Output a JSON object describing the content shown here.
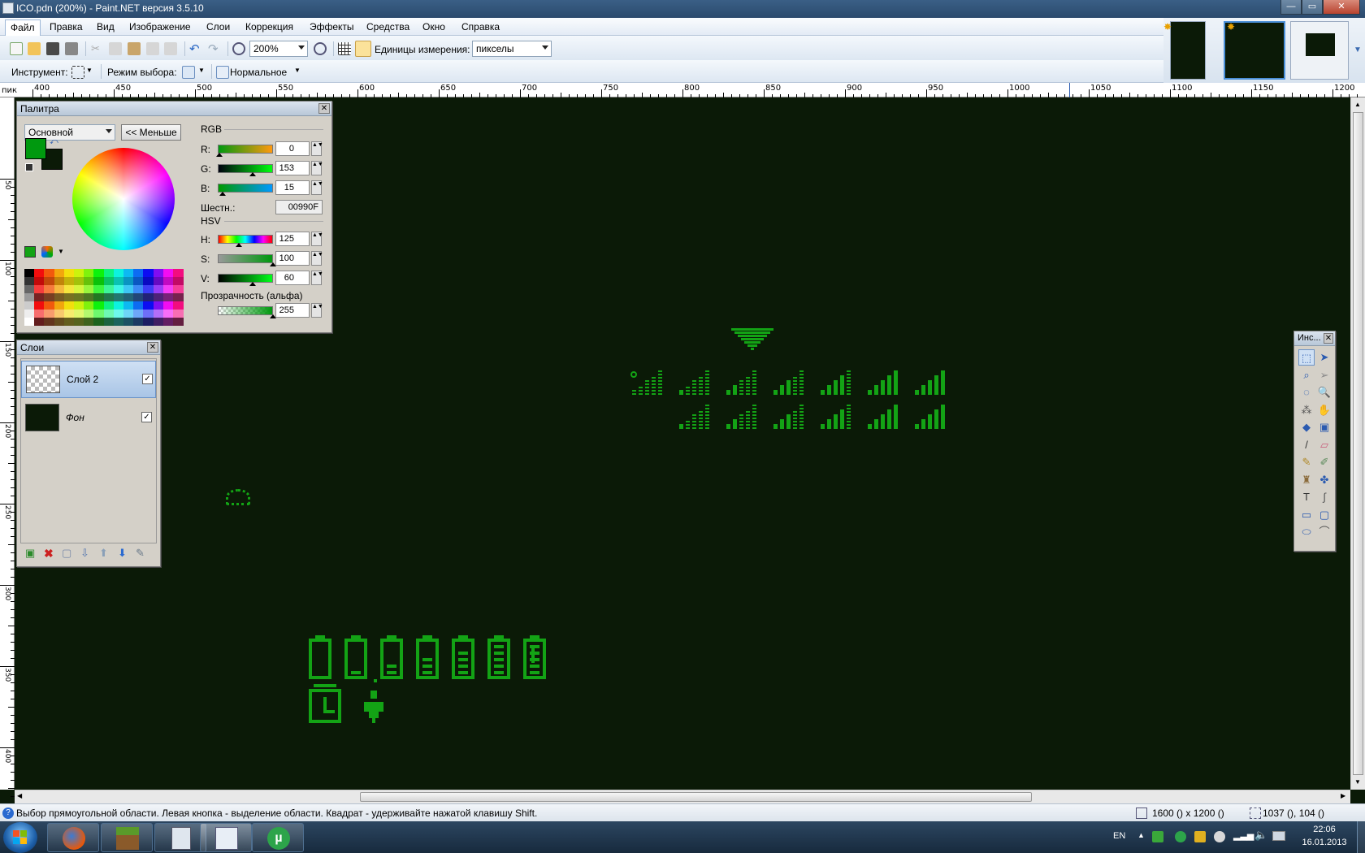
{
  "window": {
    "title": "ICO.pdn (200%) - Paint.NET версия 3.5.10",
    "minimize": "—",
    "maximize": "▭",
    "close": "✕"
  },
  "menu": [
    "Файл",
    "Правка",
    "Вид",
    "Изображение",
    "Слои",
    "Коррекция",
    "Эффекты",
    "Средства",
    "Окно",
    "Справка"
  ],
  "toolbar": {
    "zoom_value": "200%",
    "units_label": "Единицы измерения:",
    "units_value": "пикселы",
    "tool_label": "Инструмент:",
    "selection_mode_label": "Режим выбора:",
    "blend_mode": "Нормальное"
  },
  "ruler": {
    "unit": "пик",
    "h_ticks": [
      "400",
      "450",
      "500",
      "550",
      "600",
      "650",
      "700",
      "750",
      "800",
      "850",
      "900",
      "950",
      "1000",
      "1050",
      "1100",
      "1150",
      "1200"
    ],
    "v_ticks": [
      "50",
      "100",
      "150",
      "200",
      "250",
      "300",
      "350",
      "400"
    ]
  },
  "palette": {
    "title": "Палитра",
    "mode": "Основной",
    "less_button": "<< Меньше",
    "rgb_header": "RGB",
    "r_label": "R:",
    "r_value": "0",
    "g_label": "G:",
    "g_value": "153",
    "b_label": "B:",
    "b_value": "15",
    "hex_label": "Шестн.:",
    "hex_value": "00990F",
    "hsv_header": "HSV",
    "h_label": "H:",
    "h_value": "125",
    "s_label": "S:",
    "s_value": "100",
    "v_label": "V:",
    "v_value": "60",
    "alpha_label": "Прозрачность (альфа)",
    "alpha_value": "255",
    "primary_color": "#00990f",
    "secondary_color": "#0b1a07"
  },
  "layers": {
    "title": "Слои",
    "items": [
      {
        "name": "Слой 2",
        "visible": true,
        "selected": true
      },
      {
        "name": "Фон",
        "visible": true,
        "selected": false
      }
    ]
  },
  "tools": {
    "title": "Инс..."
  },
  "status": {
    "hint": "Выбор прямоугольной области. Левая кнопка - выделение области. Квадрат - удерживайте нажатой клавишу Shift.",
    "image_size": "1600 () x 1200 ()",
    "cursor_pos": "1037 (), 104 ()"
  },
  "taskbar": {
    "lang": "EN",
    "time": "22:06",
    "date": "16.01.2013"
  },
  "colors": {
    "canvas": "#0b1a07",
    "icon_green": "#13a315"
  }
}
